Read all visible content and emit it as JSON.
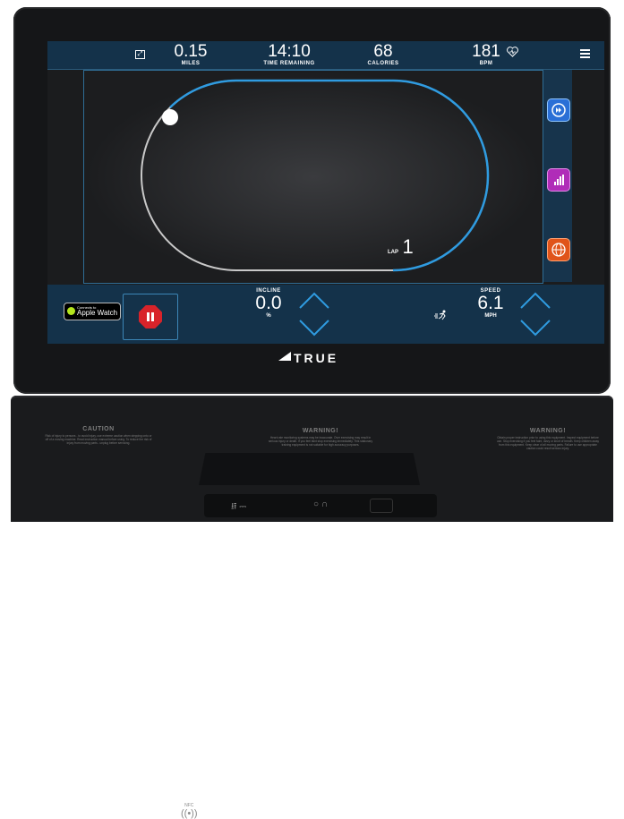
{
  "topbar": {
    "stats": [
      {
        "value": "0.15",
        "label": "MILES"
      },
      {
        "value": "14:10",
        "label": "TIME REMAINING"
      },
      {
        "value": "68",
        "label": "CALORIES"
      },
      {
        "value": "181",
        "label": "BPM"
      }
    ]
  },
  "track": {
    "lap_label": "LAP",
    "lap_value": "1"
  },
  "right_panel": {
    "buttons": [
      {
        "icon": "fast-forward-icon",
        "color": "#2a6fd6"
      },
      {
        "icon": "signal-bars-icon",
        "color": "#b02cb8"
      },
      {
        "icon": "globe-icon",
        "color": "#e0541a"
      }
    ]
  },
  "apple_watch": {
    "small": "Connects to",
    "big": "Apple Watch"
  },
  "incline": {
    "label": "INCLINE",
    "value": "0.0",
    "unit": "%"
  },
  "speed": {
    "label": "SPEED",
    "value": "6.1",
    "unit": "MPH"
  },
  "brand": "TRUE",
  "console": {
    "nfc": "NFC",
    "caution": {
      "title": "CAUTION",
      "body": "Risk of injury to persons - to avoid injury, use extreme caution when stepping onto or off of a moving machine. Read instruction manual before using. To reduce the risk of injury from moving parts - unplug before servicing."
    },
    "warning_center": {
      "title": "WARNING!",
      "body": "Heart rate monitoring systems may be inaccurate. Over exercising may result in serious injury or death. If you feel faint stop exercising immediately. This stationary training equipment is not suitable for high accuracy purposes."
    },
    "warning_right": {
      "title": "WARNING!",
      "body": "Obtain proper instruction prior to using this equipment. Inspect equipment before use. Stop exercising if you feel faint, dizzy or short of breath. Keep children away from this equipment. Keep clear of all moving parts. Failure to use appropriate caution could result serious injury."
    }
  },
  "colors": {
    "accent": "#2f9be0",
    "stop": "#d8232a",
    "bar": "#14324a"
  }
}
